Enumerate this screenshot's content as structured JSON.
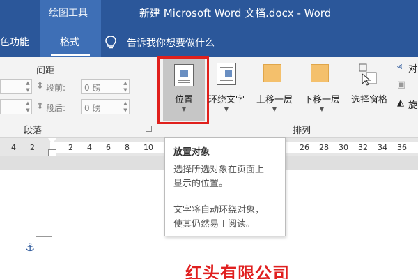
{
  "title_bar": {
    "context_label": "绘图工具",
    "doc_title": "新建 Microsoft Word 文档.docx  -  Word"
  },
  "tabs": [
    {
      "label": "色功能"
    },
    {
      "label": "格式"
    }
  ],
  "tell_me": {
    "text": "告诉我你想要做什么"
  },
  "ribbon": {
    "spacing_title": "间距",
    "before_label": "段前:",
    "before_value": "0 磅",
    "after_label": "段后:",
    "after_value": "0 磅",
    "paragraph_group": "段落",
    "arrange_group": "排列",
    "buttons": {
      "position": "位置",
      "wrap_text": "环绕文字",
      "bring_forward": "上移一层",
      "send_backward": "下移一层",
      "selection_pane": "选择窗格",
      "align_partial": "对",
      "rotate_partial": "旋"
    }
  },
  "ruler": {
    "numbers": [
      "4",
      "2",
      "2",
      "4",
      "6",
      "8",
      "10",
      "26",
      "28",
      "30",
      "32",
      "34",
      "36"
    ]
  },
  "tooltip": {
    "title": "放置对象",
    "line1": "选择所选对象在页面上",
    "line2": "显示的位置。",
    "line3": "文字将自动环绕对象，",
    "line4": "使其仍然易于阅读。"
  },
  "document": {
    "heading": "红头有限公司"
  },
  "colors": {
    "title_blue": "#2b579a",
    "highlight_red": "#e0201c",
    "heading_red": "#e02020"
  }
}
